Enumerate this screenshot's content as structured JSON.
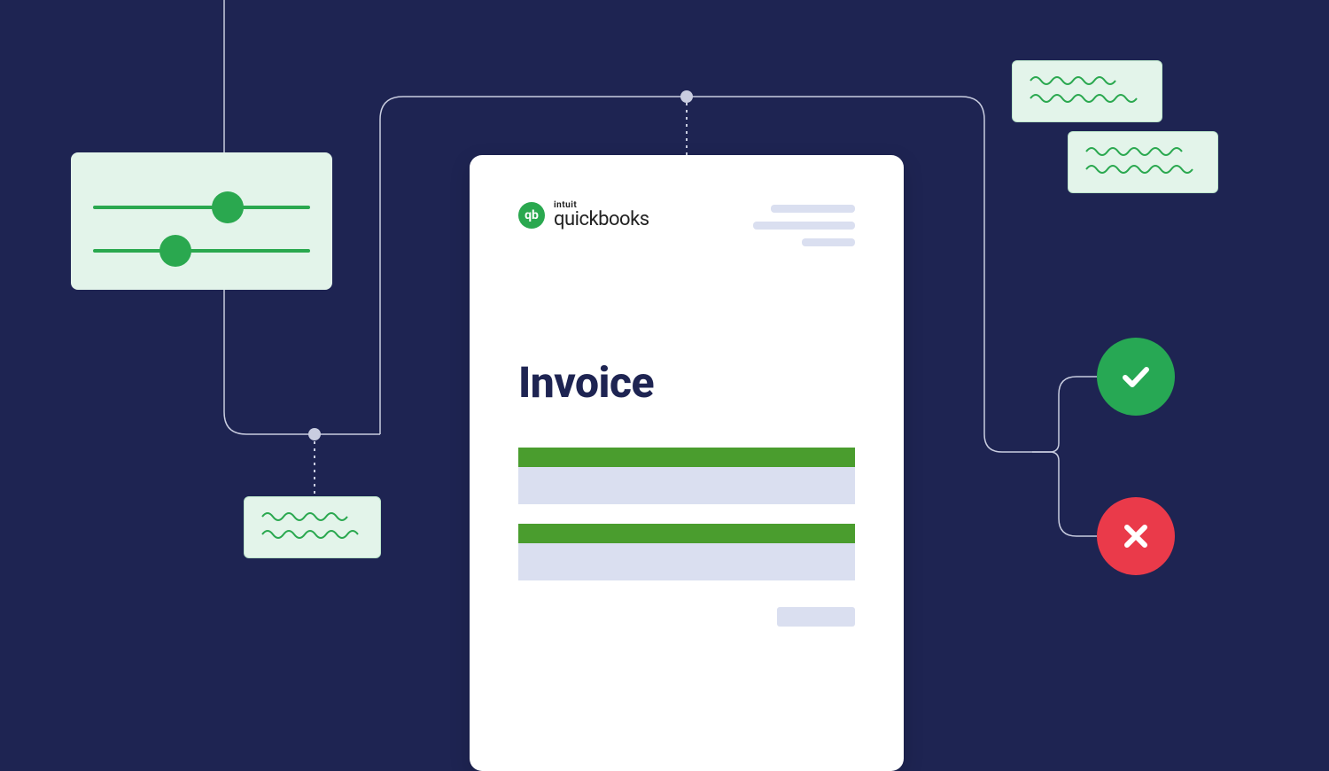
{
  "invoice": {
    "brand_top": "intuit",
    "brand_name": "quickbooks",
    "logo_mark": "qb",
    "title": "Invoice"
  },
  "settings": {
    "slider1_pos": 0.62,
    "slider2_pos": 0.38
  },
  "status": {
    "ok_icon": "check-icon",
    "err_icon": "close-icon"
  },
  "colors": {
    "bg": "#1e2452",
    "mint": "#e3f4ea",
    "green": "#2aa84f",
    "green_dark": "#4a9d2e",
    "red": "#ea3a4a",
    "placeholder": "#dadff0"
  }
}
